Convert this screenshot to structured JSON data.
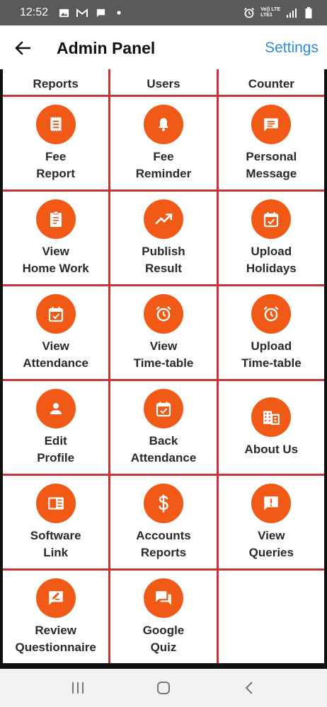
{
  "status_bar": {
    "time": "12:52",
    "left_icons": [
      "image-icon",
      "gmail-icon",
      "chat-icon",
      "dot-icon"
    ],
    "right_icons": [
      "alarm-icon",
      "volte-icon",
      "signal-icon",
      "battery-icon"
    ],
    "network_label_top": "Vo)) LTE",
    "network_label_bottom": "LTE1"
  },
  "app_bar": {
    "title": "Admin Panel",
    "settings_label": "Settings"
  },
  "colors": {
    "accent": "#f15a16",
    "grid_line": "#c9343c",
    "link": "#2f8bd8"
  },
  "top_row": [
    {
      "label": "Reports"
    },
    {
      "label": "Users"
    },
    {
      "label": "Counter"
    }
  ],
  "tiles": [
    {
      "icon": "receipt-icon",
      "line1": "Fee",
      "line2": "Report"
    },
    {
      "icon": "bell-icon",
      "line1": "Fee",
      "line2": "Reminder"
    },
    {
      "icon": "message-icon",
      "line1": "Personal",
      "line2": "Message"
    },
    {
      "icon": "clipboard-icon",
      "line1": "View",
      "line2": "Home Work"
    },
    {
      "icon": "trending-up-icon",
      "line1": "Publish",
      "line2": "Result"
    },
    {
      "icon": "calendar-check-icon",
      "line1": "Upload",
      "line2": "Holidays"
    },
    {
      "icon": "calendar-check-icon",
      "line1": "View",
      "line2": "Attendance"
    },
    {
      "icon": "alarm-clock-icon",
      "line1": "View",
      "line2": "Time-table"
    },
    {
      "icon": "alarm-clock-icon",
      "line1": "Upload",
      "line2": "Time-table"
    },
    {
      "icon": "person-icon",
      "line1": "Edit",
      "line2": "Profile"
    },
    {
      "icon": "calendar-check-icon",
      "line1": "Back",
      "line2": "Attendance"
    },
    {
      "icon": "building-icon",
      "line1": "About Us",
      "line2": ""
    },
    {
      "icon": "document-icon",
      "line1": "Software",
      "line2": "Link"
    },
    {
      "icon": "dollar-icon",
      "line1": "Accounts",
      "line2": "Reports"
    },
    {
      "icon": "feedback-icon",
      "line1": "View",
      "line2": "Queries"
    },
    {
      "icon": "edit-note-icon",
      "line1": "Review",
      "line2": "Questionnaire"
    },
    {
      "icon": "forum-icon",
      "line1": "Google",
      "line2": "Quiz"
    }
  ],
  "nav_bar": {
    "buttons": [
      "recents-icon",
      "home-icon",
      "back-nav-icon"
    ]
  }
}
